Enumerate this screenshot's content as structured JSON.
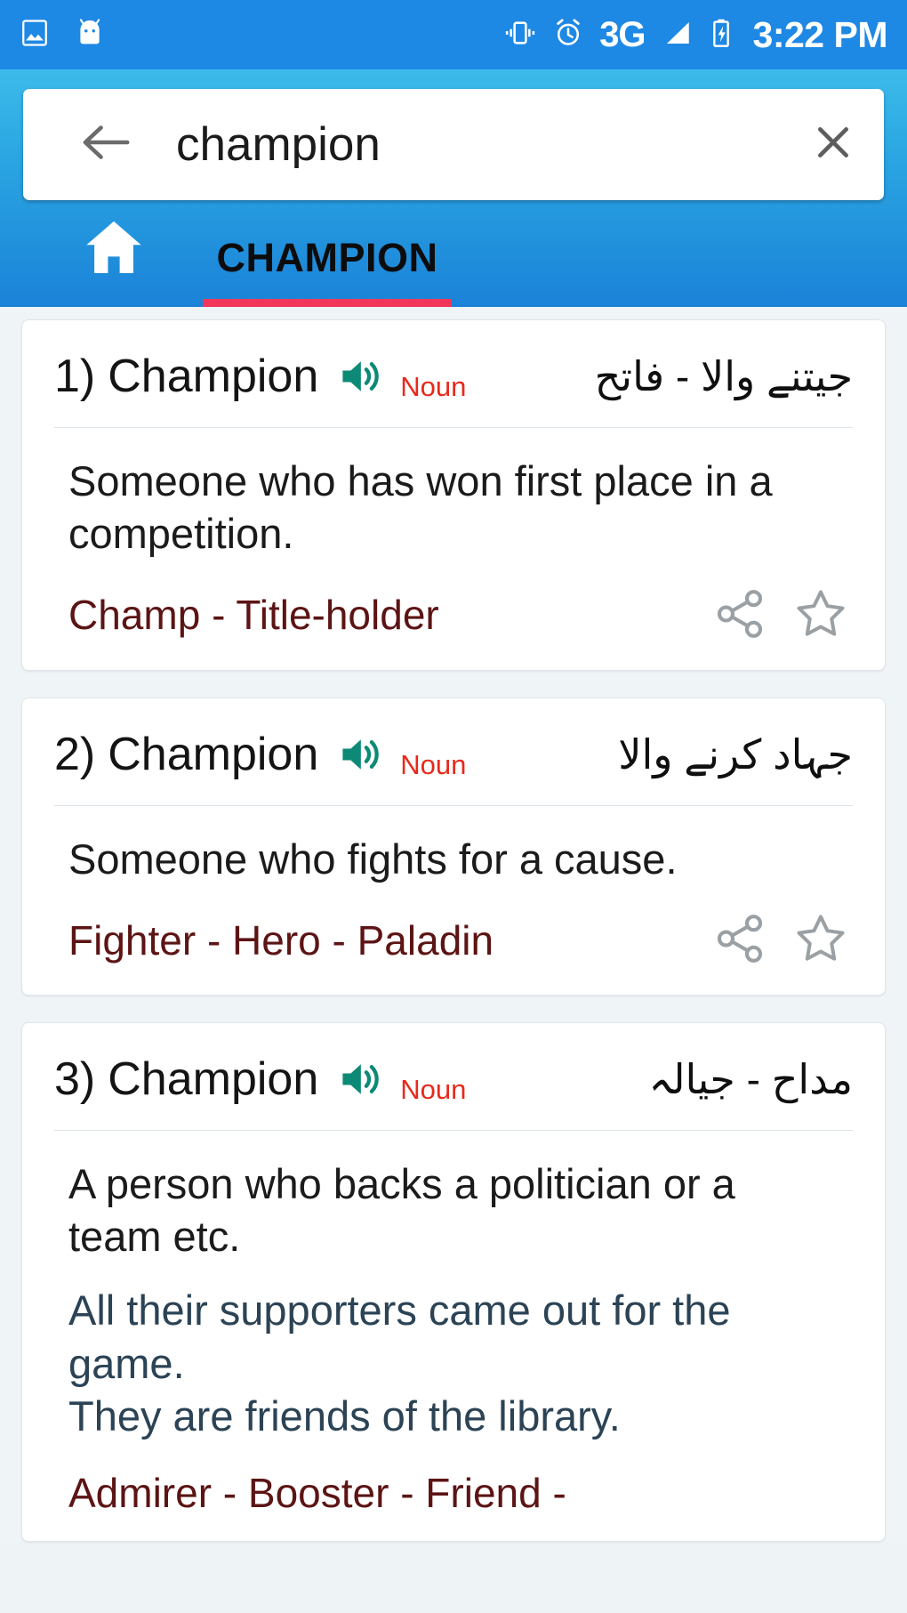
{
  "status_bar": {
    "icons_left": [
      "image-icon",
      "android-robot-icon"
    ],
    "icons_right": [
      "vibrate-icon",
      "alarm-icon",
      "signal-icon",
      "battery-charging-icon"
    ],
    "network_label": "3G",
    "time": "3:22 PM",
    "background_color": "#1e88e5"
  },
  "app_bar": {
    "background_color": "#2aa5e2",
    "search": {
      "value": "champion",
      "placeholder": "Search word",
      "back_icon": "back-arrow-icon",
      "clear_icon": "close-icon"
    },
    "home_icon": "home-icon",
    "tabs": [
      {
        "label": "CHAMPION",
        "selected": true,
        "indicator_color": "#f2385a"
      }
    ]
  },
  "accent_colors": {
    "pos_tag": "#e8291c",
    "speaker": "#0d8a75",
    "synonyms": "#5c1414",
    "example": "#2b4355",
    "tab_indicator": "#f2385a"
  },
  "entries": [
    {
      "index": "1)",
      "word": "Champion",
      "speaker_icon": "speaker-icon",
      "pos": "Noun",
      "urdu": "جیتنے والا - فاتح",
      "definition": "Someone who has won first place in a competition.",
      "examples": [],
      "synonyms": "Champ - Title-holder",
      "share_icon": "share-icon",
      "favorite_icon": "star-outline-icon"
    },
    {
      "index": "2)",
      "word": "Champion",
      "speaker_icon": "speaker-icon",
      "pos": "Noun",
      "urdu": "جہاد کرنے والا",
      "definition": "Someone who fights for a cause.",
      "examples": [],
      "synonyms": "Fighter - Hero - Paladin",
      "share_icon": "share-icon",
      "favorite_icon": "star-outline-icon"
    },
    {
      "index": "3)",
      "word": "Champion",
      "speaker_icon": "speaker-icon",
      "pos": "Noun",
      "urdu": "مداح - جیالہ",
      "definition": "A person who backs a politician or a team etc.",
      "examples": [
        "All their supporters came out for the game.",
        "They are friends of the library."
      ],
      "synonyms": "Admirer - Booster - Friend -",
      "share_icon": "share-icon",
      "favorite_icon": "star-outline-icon"
    }
  ]
}
